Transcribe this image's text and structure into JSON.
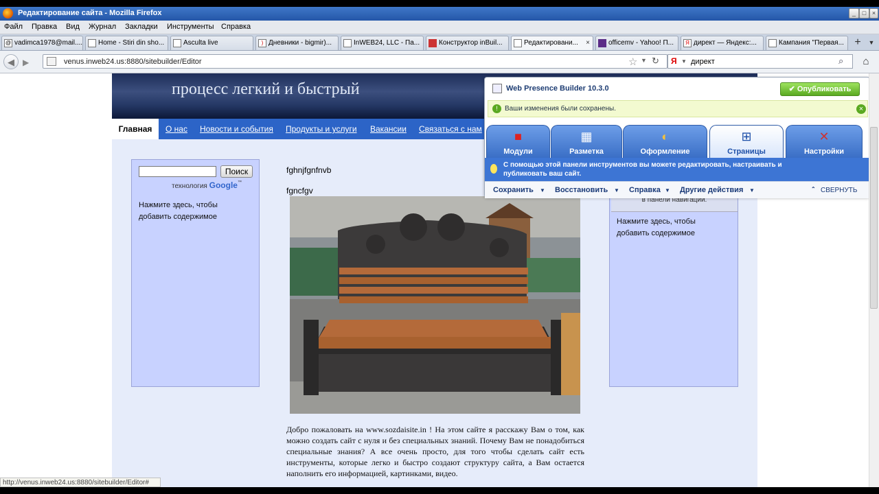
{
  "window": {
    "title": "Редактирование сайта - Mozilla Firefox"
  },
  "menu": [
    "Файл",
    "Правка",
    "Вид",
    "Журнал",
    "Закладки",
    "Инструменты",
    "Справка"
  ],
  "tabs": [
    {
      "label": "vadimca1978@mail....",
      "active": false
    },
    {
      "label": "Home - Stiri din sho...",
      "active": false
    },
    {
      "label": "Asculta live",
      "active": false
    },
    {
      "label": "Дневники - bigmir)...",
      "active": false
    },
    {
      "label": "InWEB24, LLC - Па...",
      "active": false
    },
    {
      "label": "Конструктор inBuil...",
      "active": false
    },
    {
      "label": "Редактировани...",
      "active": true
    },
    {
      "label": "officemv - Yahoo! П...",
      "active": false
    },
    {
      "label": "директ — Яндекс:...",
      "active": false
    },
    {
      "label": "Кампания \"Первая...",
      "active": false
    }
  ],
  "nav": {
    "url": "venus.inweb24.us:8880/sitebuilder/Editor",
    "search_value": "директ"
  },
  "site": {
    "slogan": "процесс легкий и быстрый",
    "nav_items": [
      "Главная",
      "О нас",
      "Новости и события",
      "Продукты и услуги",
      "Вакансии",
      "Связаться с нам"
    ],
    "search_button": "Поиск",
    "powered_by": "технология",
    "google": "Google",
    "tm": "™",
    "left_placeholder_1": "Нажмите здесь, чтобы",
    "left_placeholder_2": "добавить содержимое",
    "text1": "fghnjfgnfnvb",
    "text2": "fgncfgv",
    "right_nav_hint": "в панели навигации.",
    "right_placeholder_1": "Нажмите здесь, чтобы",
    "right_placeholder_2": "добавить содержимое",
    "welcome_text": "Добро пожаловать на www.sozdaisite.in ! На этом сайте я расскажу Вам о том, как можно создать сайт с нуля и без специальных знаний. Почему Вам не понадобиться специальные знания? А все очень просто, для того чтобы сделать сайт есть инструменты, которые легко и быстро создают структуру сайта, а Вам остается наполнить его информацией, картинками, видео."
  },
  "builder": {
    "title": "Web Presence Builder 10.3.0",
    "publish": "Опубликовать",
    "saved_msg": "Ваши изменения были сохранены.",
    "tabs": [
      {
        "label": "Модули",
        "icon": "modules-icon"
      },
      {
        "label": "Разметка",
        "icon": "layout-icon"
      },
      {
        "label": "Оформление",
        "icon": "design-icon"
      },
      {
        "label": "Страницы",
        "icon": "pages-icon"
      },
      {
        "label": "Настройки",
        "icon": "settings-icon"
      }
    ],
    "hint_line1": "С помощью этой панели инструментов вы можете редактировать, настраивать и",
    "hint_line2": "публиковать ваш сайт.",
    "actions": [
      "Сохранить",
      "Восстановить",
      "Справка",
      "Другие действия"
    ],
    "collapse": "СВЕРНУТЬ"
  },
  "status": {
    "text": "http://venus.inweb24.us:8880/sitebuilder/Editor#"
  },
  "colors": {
    "accent": "#2c64c7",
    "sidebar": "#c8d2ff",
    "publish": "#5aa921"
  }
}
